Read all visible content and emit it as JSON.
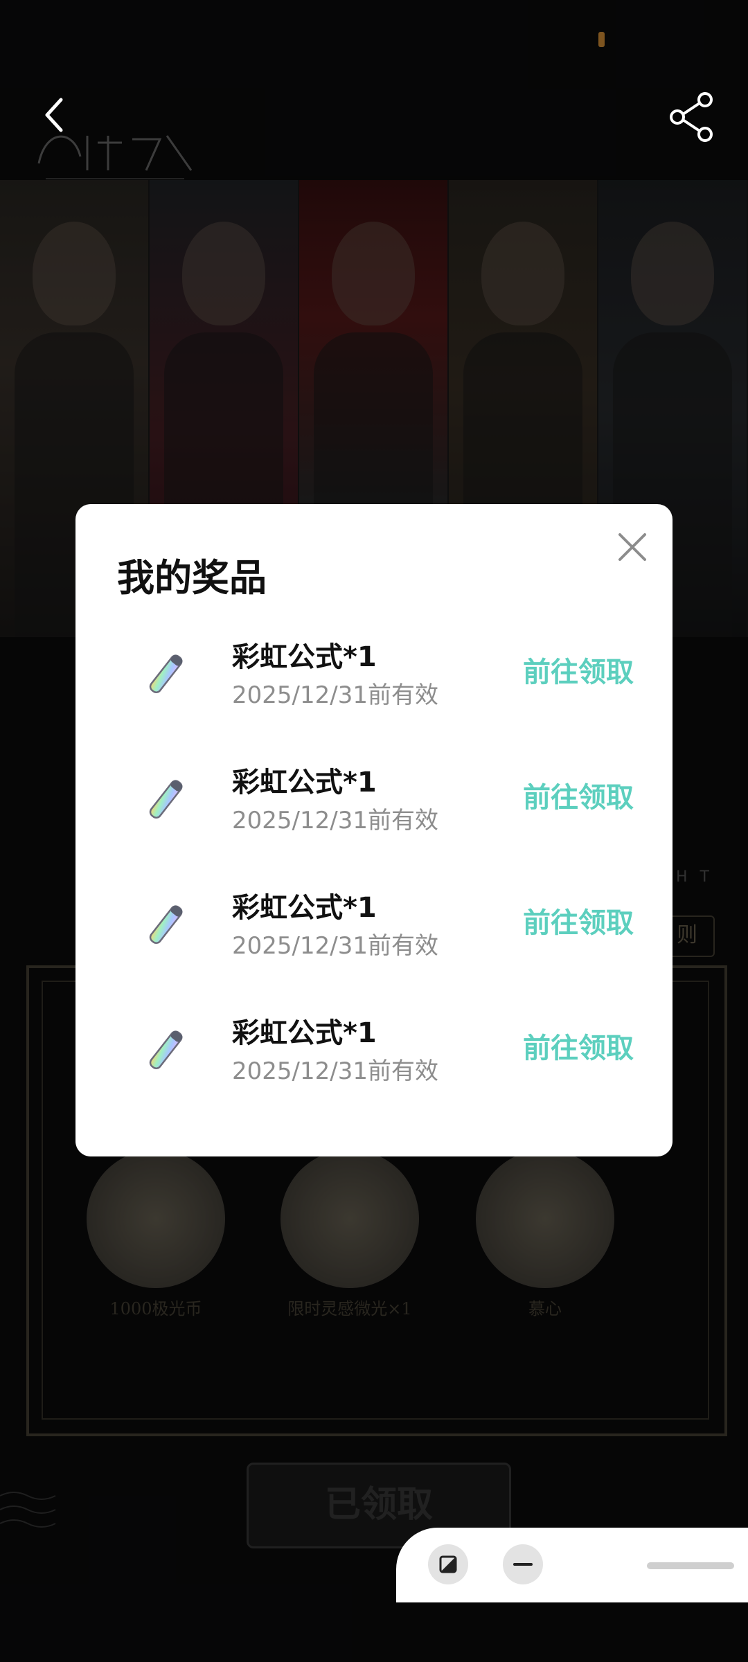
{
  "header": {
    "back_icon": "chevron-left-icon",
    "share_icon": "share-icon"
  },
  "background": {
    "claimed_button_label": "已领取",
    "prizes": [
      {
        "label": "1000极光币"
      },
      {
        "label": "限时灵感微光×1"
      },
      {
        "label": "慕心"
      }
    ]
  },
  "modal": {
    "title": "我的奖品",
    "close_icon": "close-icon",
    "items": [
      {
        "name": "彩虹公式*1",
        "expiry": "2025/12/31前有效",
        "action": "前往领取",
        "icon": "rainbow-pen-icon"
      },
      {
        "name": "彩虹公式*1",
        "expiry": "2025/12/31前有效",
        "action": "前往领取",
        "icon": "rainbow-pen-icon"
      },
      {
        "name": "彩虹公式*1",
        "expiry": "2025/12/31前有效",
        "action": "前往领取",
        "icon": "rainbow-pen-icon"
      },
      {
        "name": "彩虹公式*1",
        "expiry": "2025/12/31前有效",
        "action": "前往领取",
        "icon": "rainbow-pen-icon"
      }
    ]
  },
  "colors": {
    "accent": "#5ccfbe",
    "modal_bg": "#ffffff"
  }
}
